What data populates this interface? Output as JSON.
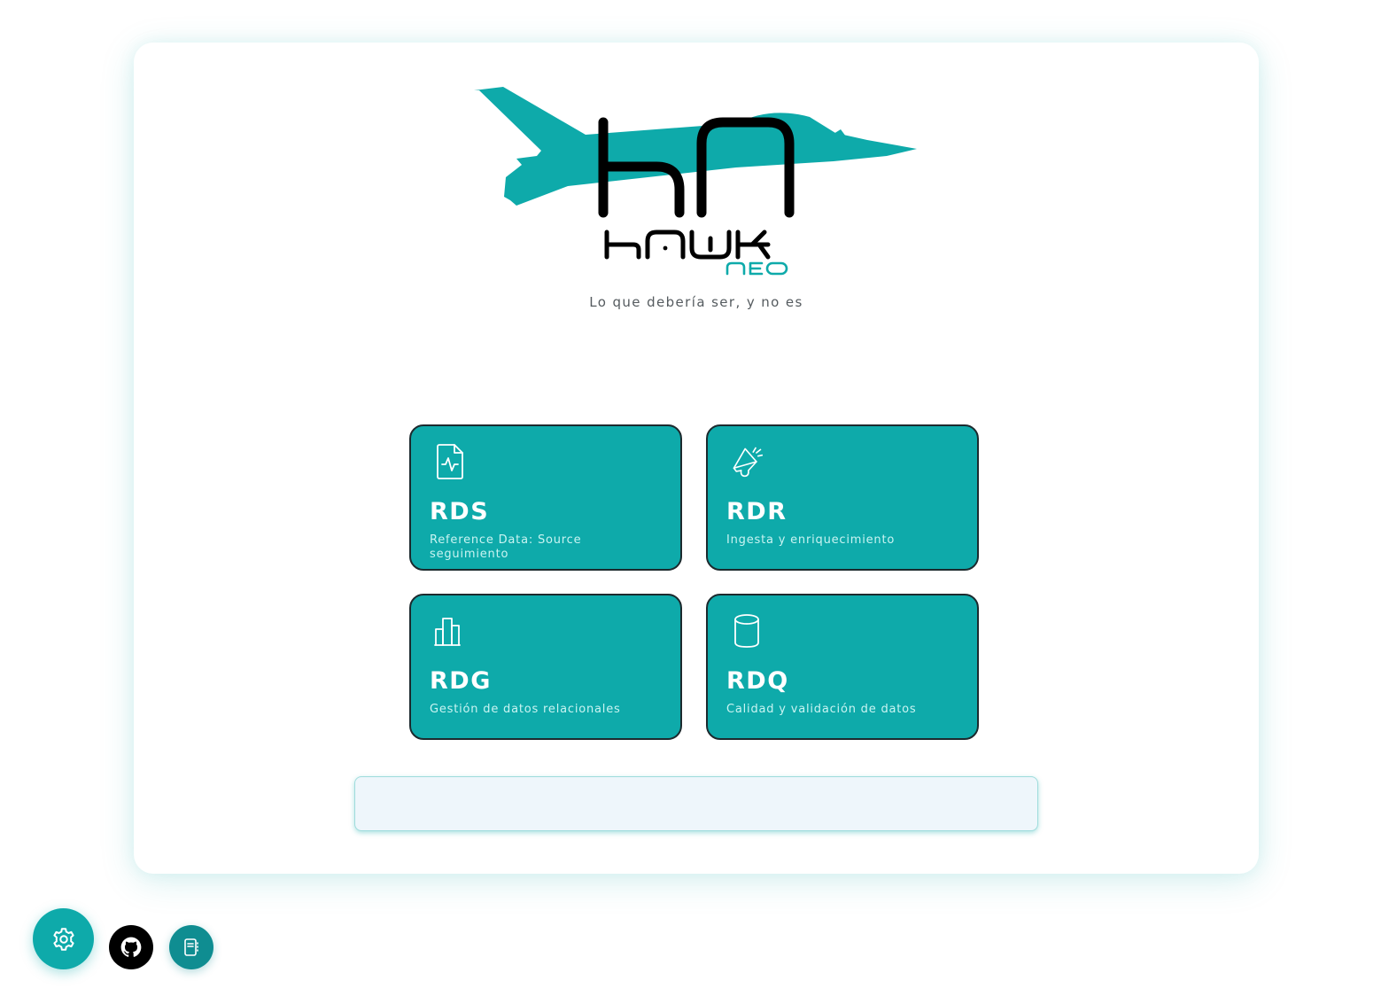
{
  "app": {
    "logo_mark": "HN",
    "logo_name": "HAWK",
    "logo_sub": "NEO",
    "tagline": "Lo que debería ser, y no es"
  },
  "colors": {
    "accent": "#0eaaaa",
    "card_border": "#1c2a2e",
    "logo_text": "#000000",
    "search_bg": "#eef6fb"
  },
  "modules": [
    {
      "code": "RDS",
      "description": "Reference Data: Source seguimiento",
      "icon": "file-activity-icon"
    },
    {
      "code": "RDR",
      "description": "Ingesta y enriquecimiento",
      "icon": "megaphone-icon"
    },
    {
      "code": "RDG",
      "description": "Gestión de datos relacionales",
      "icon": "bar-chart-icon"
    },
    {
      "code": "RDQ",
      "description": "Calidad y validación de datos",
      "icon": "database-icon"
    }
  ],
  "search": {
    "value": "",
    "placeholder": ""
  },
  "floating_buttons": [
    {
      "name": "settings",
      "icon": "gear-icon"
    },
    {
      "name": "github",
      "icon": "github-icon"
    },
    {
      "name": "docs",
      "icon": "notebook-icon"
    }
  ]
}
